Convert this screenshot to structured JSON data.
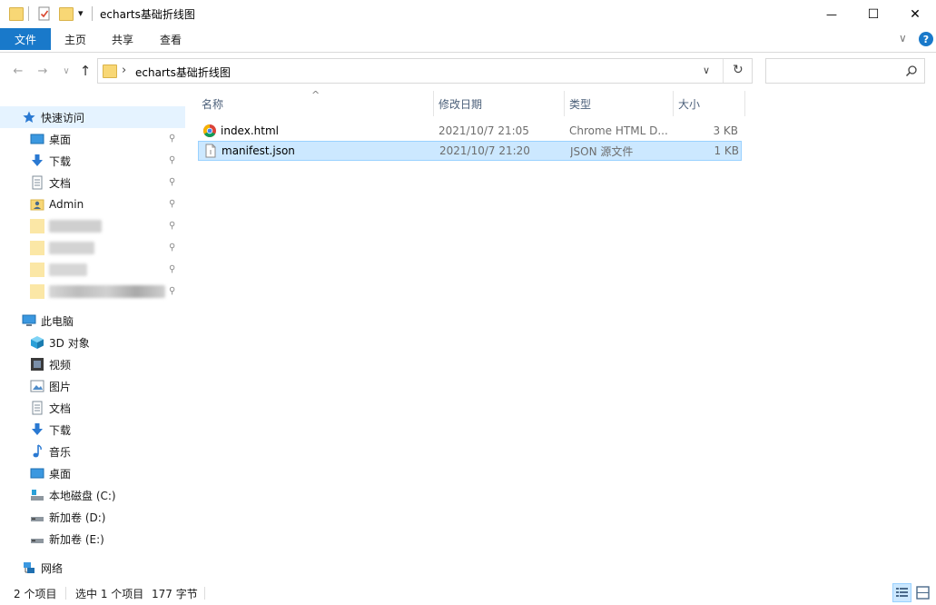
{
  "window": {
    "title": "echarts基础折线图",
    "minimize_glyph": "—",
    "maximize_glyph": "☐",
    "close_glyph": "✕"
  },
  "quick_access_toolbar": {
    "dropdown_glyph": "▾"
  },
  "ribbon": {
    "tabs": [
      {
        "label": "文件"
      },
      {
        "label": "主页"
      },
      {
        "label": "共享"
      },
      {
        "label": "查看"
      }
    ],
    "expand_glyph": "∨",
    "help_glyph": "?"
  },
  "navigation": {
    "back_glyph": "←",
    "forward_glyph": "→",
    "recent_glyph": "∨",
    "up_glyph": "↑"
  },
  "address": {
    "separator_glyph": "›",
    "current_folder": "echarts基础折线图",
    "dropdown_glyph": "∨",
    "refresh_glyph": "↻"
  },
  "search": {
    "placeholder": "",
    "icon": "search-icon"
  },
  "nav_pane": {
    "quick_access": {
      "label": "快速访问",
      "items": [
        {
          "label": "桌面",
          "icon": "desktop-icon"
        },
        {
          "label": "下载",
          "icon": "download-icon"
        },
        {
          "label": "文档",
          "icon": "documents-icon"
        },
        {
          "label": "Admin",
          "icon": "user-folder-icon"
        }
      ]
    },
    "this_pc": {
      "label": "此电脑",
      "items": [
        {
          "label": "3D 对象",
          "icon": "3d-objects-icon"
        },
        {
          "label": "视频",
          "icon": "videos-icon"
        },
        {
          "label": "图片",
          "icon": "pictures-icon"
        },
        {
          "label": "文档",
          "icon": "documents-icon"
        },
        {
          "label": "下载",
          "icon": "download-icon"
        },
        {
          "label": "音乐",
          "icon": "music-icon"
        },
        {
          "label": "桌面",
          "icon": "desktop-icon"
        },
        {
          "label": "本地磁盘 (C:)",
          "icon": "system-drive-icon"
        },
        {
          "label": "新加卷 (D:)",
          "icon": "drive-icon"
        },
        {
          "label": "新加卷 (E:)",
          "icon": "drive-icon"
        }
      ]
    },
    "network": {
      "label": "网络"
    }
  },
  "file_list": {
    "columns": [
      {
        "label": "名称"
      },
      {
        "label": "修改日期"
      },
      {
        "label": "类型"
      },
      {
        "label": "大小"
      }
    ],
    "sort_glyph": "^",
    "rows": [
      {
        "name": "index.html",
        "date": "2021/10/7 21:05",
        "type": "Chrome HTML D...",
        "size": "3 KB",
        "icon": "chrome-icon",
        "selected": false
      },
      {
        "name": "manifest.json",
        "date": "2021/10/7 21:20",
        "type": "JSON 源文件",
        "size": "1 KB",
        "icon": "json-file-icon",
        "selected": true
      }
    ]
  },
  "status_bar": {
    "item_count": "2 个项目",
    "selection": "选中 1 个项目",
    "size": "177 字节"
  },
  "colors": {
    "accent": "#1979ca",
    "selection_bg": "#cce8ff",
    "selection_border": "#99d1ff",
    "folder": "#f8d775",
    "header_text": "#4c607a"
  }
}
